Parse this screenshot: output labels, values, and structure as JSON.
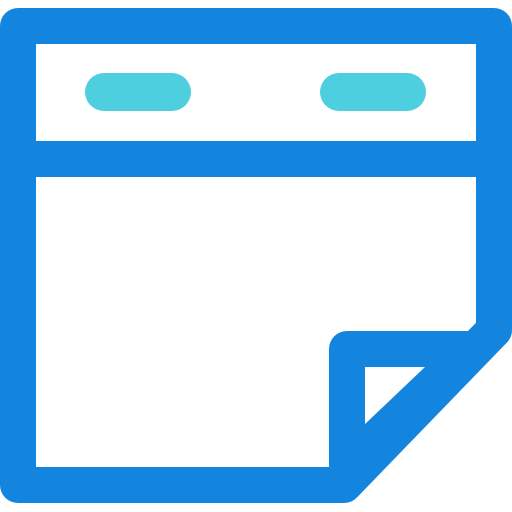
{
  "icon": {
    "name": "calendar-sticky-note-icon",
    "colors": {
      "outline": "#1485DE",
      "accent": "#4ECFE0",
      "fill": "#FFFFFF"
    }
  }
}
